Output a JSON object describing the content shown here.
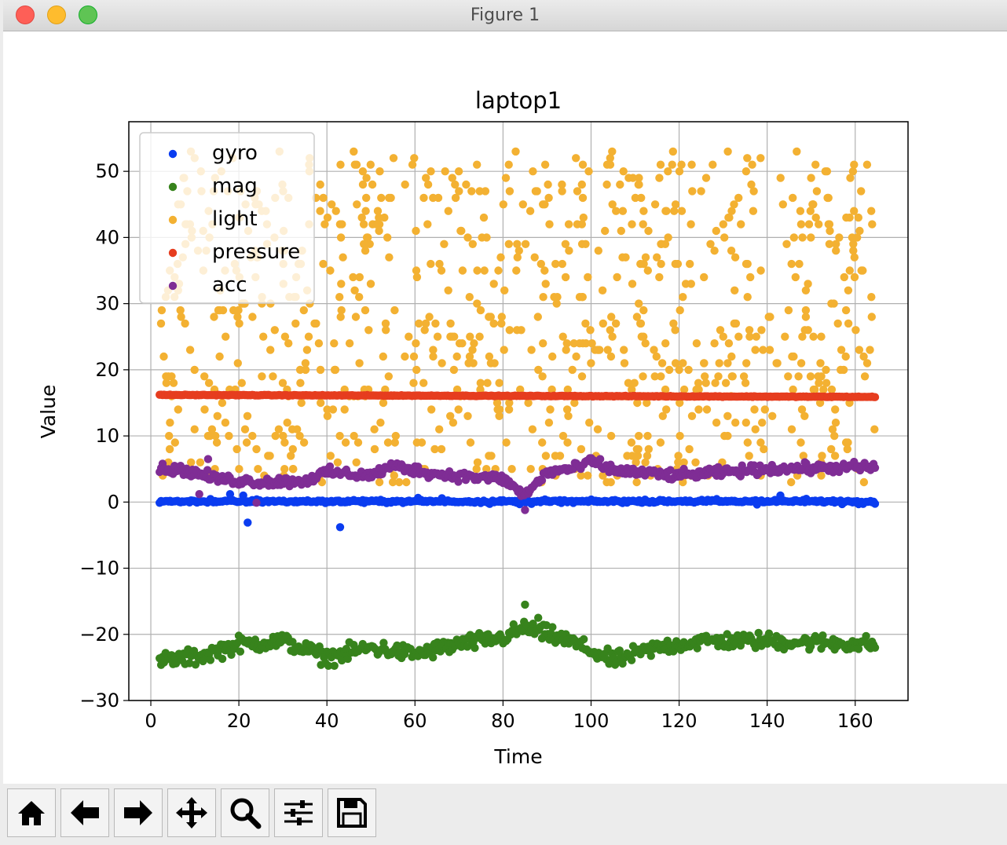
{
  "window": {
    "title": "Figure 1"
  },
  "toolbar": {
    "buttons": [
      {
        "name": "home-button",
        "icon": "home-icon"
      },
      {
        "name": "back-button",
        "icon": "arrow-left-icon"
      },
      {
        "name": "forward-button",
        "icon": "arrow-right-icon"
      },
      {
        "name": "pan-button",
        "icon": "move-icon"
      },
      {
        "name": "zoom-button",
        "icon": "magnifier-icon"
      },
      {
        "name": "configure-subplots-button",
        "icon": "sliders-icon"
      },
      {
        "name": "save-button",
        "icon": "floppy-disk-icon"
      }
    ]
  },
  "chart_data": {
    "type": "scatter",
    "title": "laptop1",
    "xlabel": "Time",
    "ylabel": "Value",
    "xlim": [
      -5,
      172
    ],
    "ylim": [
      -30,
      57.5
    ],
    "xticks": [
      0,
      20,
      40,
      60,
      80,
      100,
      120,
      140,
      160
    ],
    "yticks": [
      -30,
      -20,
      -10,
      0,
      10,
      20,
      30,
      40,
      50
    ],
    "x_range": [
      2,
      164.5
    ],
    "grid": true,
    "legend_position": "upper left",
    "series": [
      {
        "name": "gyro",
        "color": "#0a3cf0",
        "points": 480,
        "mean": 0.1,
        "spread": 0.5,
        "outliers": [
          [
            22,
            -3.1
          ],
          [
            43,
            -3.8
          ],
          [
            143,
            1.0
          ],
          [
            18,
            1.2
          ],
          [
            21,
            1.0
          ]
        ]
      },
      {
        "name": "mag",
        "color": "#37831c",
        "points": 480,
        "trend": [
          [
            2,
            -24
          ],
          [
            10,
            -23.5
          ],
          [
            20,
            -21.5
          ],
          [
            30,
            -21
          ],
          [
            40,
            -23.5
          ],
          [
            50,
            -22
          ],
          [
            60,
            -23
          ],
          [
            70,
            -21.5
          ],
          [
            80,
            -20.5
          ],
          [
            85,
            -19
          ],
          [
            95,
            -21
          ],
          [
            105,
            -24
          ],
          [
            115,
            -22
          ],
          [
            125,
            -21
          ],
          [
            140,
            -21
          ],
          [
            164,
            -21.5
          ]
        ],
        "spread": 1.8,
        "outliers": [
          [
            85,
            -15.5
          ],
          [
            88,
            -17.5
          ]
        ]
      },
      {
        "name": "light",
        "color": "#f3b132",
        "points": 900,
        "range": [
          3,
          53
        ]
      },
      {
        "name": "pressure",
        "color": "#e63d1f",
        "points": 480,
        "start": 16.2,
        "end": 15.9
      },
      {
        "name": "acc",
        "color": "#7f2d95",
        "points": 480,
        "trend": [
          [
            2,
            5
          ],
          [
            8,
            4.8
          ],
          [
            15,
            3.5
          ],
          [
            25,
            3
          ],
          [
            35,
            3.2
          ],
          [
            40,
            4.5
          ],
          [
            50,
            4
          ],
          [
            55,
            5.5
          ],
          [
            65,
            4.2
          ],
          [
            80,
            3.5
          ],
          [
            85,
            1
          ],
          [
            90,
            4.5
          ],
          [
            97,
            5.2
          ],
          [
            100,
            6.2
          ],
          [
            105,
            4.8
          ],
          [
            120,
            4
          ],
          [
            140,
            5
          ],
          [
            164,
            5.3
          ]
        ],
        "spread": 1.1,
        "outliers": [
          [
            13,
            6.5
          ],
          [
            24,
            -0.1
          ],
          [
            85,
            -1.2
          ],
          [
            11,
            1.2
          ]
        ]
      }
    ]
  }
}
